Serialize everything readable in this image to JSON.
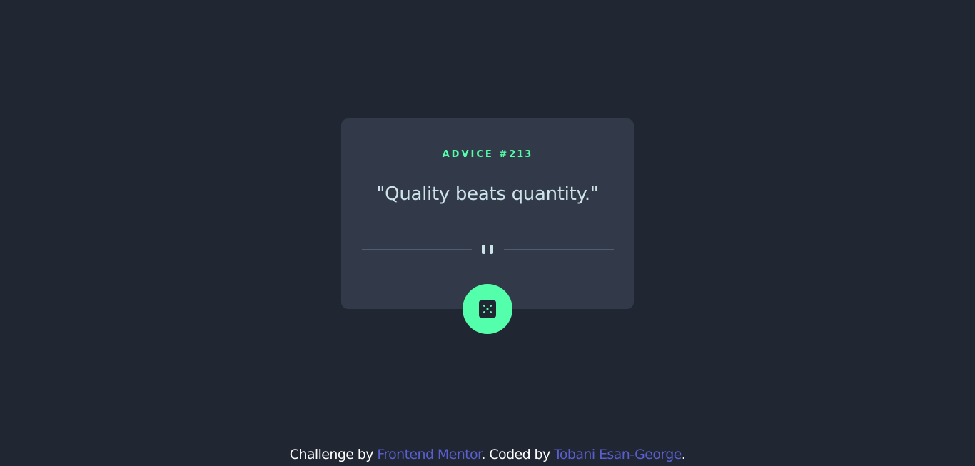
{
  "card": {
    "advice_label": "ADVICE #",
    "advice_id": "213",
    "quote": "\"Quality beats quantity.\""
  },
  "dice_button": {
    "icon": "dice-icon",
    "color": "#53ffaa"
  },
  "divider": {
    "icon": "pause-icon"
  },
  "footer": {
    "prefix": "Challenge by ",
    "link1": "Frontend Mentor",
    "middle": ". Coded by ",
    "link2": "Tobani Esan-George",
    "suffix": "."
  },
  "colors": {
    "background": "#202632",
    "card": "#323a49",
    "accent": "#53ffaa",
    "text": "#cee3e9",
    "link": "#5a5fcf"
  }
}
